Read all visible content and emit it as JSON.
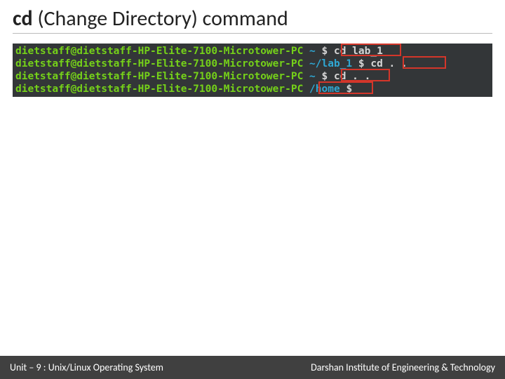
{
  "title": {
    "bold": "cd",
    "rest": " (Change Directory) command"
  },
  "terminal": {
    "prompt": "dietstaff@dietstaff-HP-Elite-7100-Microtower-PC",
    "lines": [
      {
        "path": "~",
        "cmd": "cd lab_1"
      },
      {
        "path": "~/lab_1",
        "cmd": "cd . ."
      },
      {
        "path": "~",
        "cmd": "cd . ."
      },
      {
        "path": "/home",
        "cmd": ""
      }
    ]
  },
  "footer": {
    "left": "Unit – 9 : Unix/Linux Operating System",
    "right": "Darshan Institute of Engineering & Technology"
  }
}
